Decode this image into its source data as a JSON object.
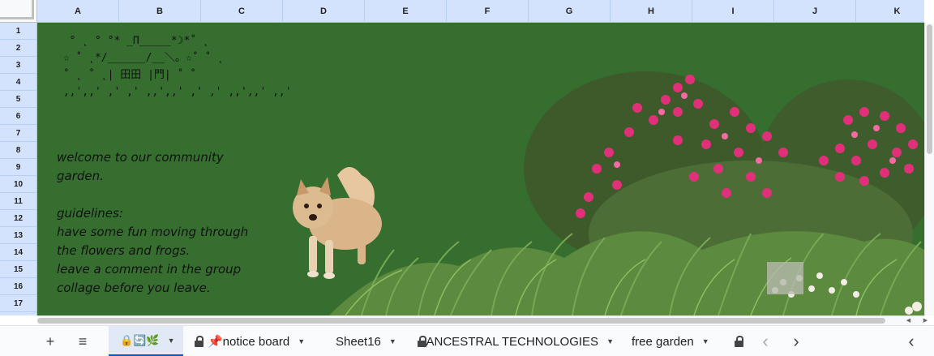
{
  "columns": [
    "A",
    "B",
    "C",
    "D",
    "E",
    "F",
    "G",
    "H",
    "I",
    "J",
    "K"
  ],
  "rows": [
    "1",
    "2",
    "3",
    "4",
    "5",
    "6",
    "7",
    "8",
    "9",
    "10",
    "11",
    "12",
    "13",
    "14",
    "15",
    "16",
    "17"
  ],
  "cells": {
    "ascii_art": "  ° ˛ ° °* _Π_____*☽*˚ ˛\n ☆ ˚ ˛*/______/__＼。☆˚ ˚ ˛\n ˚ ˛ ˚ ˛| 田田 |門| ˚ ˚\n ,,',,' ,' ,' ,,',,' ,' ,' ,,',,' ,,' ",
    "welcome_lines": [
      "welcome to our community",
      "garden.",
      "",
      "guidelines:",
      "have some fun moving through",
      "the flowers and frogs.",
      "leave a comment in the group",
      "collage before you leave."
    ]
  },
  "tabbar": {
    "add_label": "+",
    "menu_label": "≡",
    "tabs": [
      {
        "label": "🔒🔄🌿",
        "icon": "lock-icon",
        "active": true
      },
      {
        "label": "📌notice board",
        "icon": "lock-icon"
      },
      {
        "label": "Sheet16"
      },
      {
        "label": "ANCESTRAL TECHNOLOGIES",
        "icon": "lock-icon"
      },
      {
        "label": "free garden"
      }
    ],
    "prev_label": "‹",
    "next_label": "›",
    "collapse_label": "‹"
  },
  "colors": {
    "sheet_background": "#356e2f",
    "header_background": "#d3e3fd",
    "active_tab_background": "#e1e9f7",
    "accent": "#0b57d0"
  }
}
